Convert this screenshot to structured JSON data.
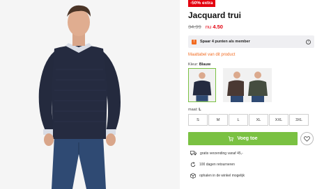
{
  "product": {
    "badge": "-50% extra",
    "title": "Jacquard trui",
    "old_price": "34.99",
    "now_label": "nu",
    "new_price": "4.50"
  },
  "loyalty": {
    "icon": "loyalty-points-icon",
    "text": "Spaar 4 punten als member",
    "info_icon": "info-icon"
  },
  "size_chart_link": "Maattabel van dit product",
  "color": {
    "label": "Kleur:",
    "value": "Blauw",
    "swatches": [
      {
        "name": "Blauw",
        "color": "#252b40"
      },
      {
        "name": "Bruin",
        "color": "#4a3933"
      },
      {
        "name": "Groen",
        "color": "#454d40"
      }
    ]
  },
  "size": {
    "label": "maat:",
    "value": "L",
    "options": [
      "S",
      "M",
      "L",
      "XL",
      "XXL",
      "3XL"
    ]
  },
  "cart": {
    "add_label": "Voeg toe",
    "icon": "cart-icon",
    "favorite_icon": "heart-icon"
  },
  "usps": [
    {
      "icon": "truck-icon",
      "text": "gratis verzending vanaf 45,-"
    },
    {
      "icon": "return-icon",
      "text": "100 dagen retourneren"
    },
    {
      "icon": "store-icon",
      "text": "ophalen in de winkel mogelijk"
    }
  ],
  "colors": {
    "accent_green": "#7ac142",
    "accent_orange": "#f26b21",
    "sale_red": "#e3000f"
  }
}
